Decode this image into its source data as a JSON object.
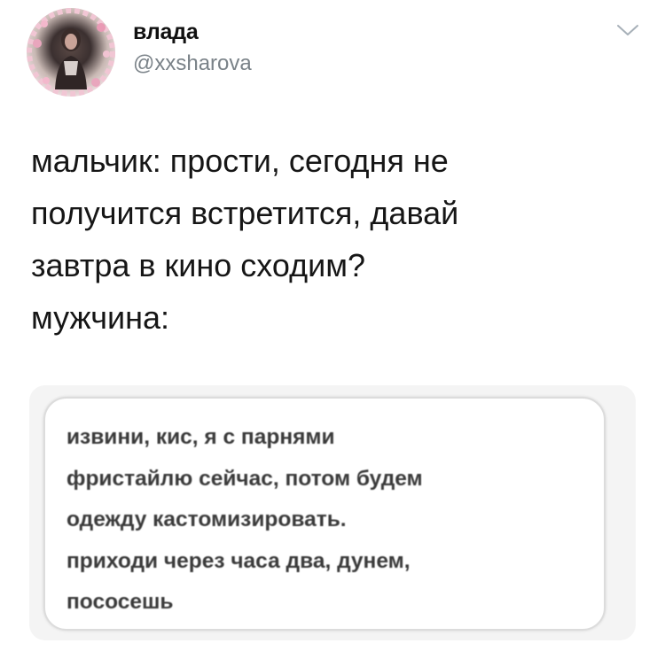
{
  "author": {
    "display_name": "влада",
    "handle": "@xxsharova"
  },
  "menu": {
    "icon": "chevron-down-icon"
  },
  "tweet": {
    "lines": [
      "мальчик: прости, сегодня не",
      "получится встретится, давай",
      "завтра в кино сходим?",
      "мужчина:"
    ]
  },
  "media": {
    "message_lines": [
      "извини, кис, я с парнями",
      "фристайлю сейчас, потом будем",
      "одежду кастомизировать.",
      "приходи через часа два, дунем,",
      "пососешь"
    ]
  },
  "colors": {
    "name": "#111111",
    "handle": "#7a8288",
    "text": "#161616",
    "media_bg": "#f4f4f4"
  }
}
